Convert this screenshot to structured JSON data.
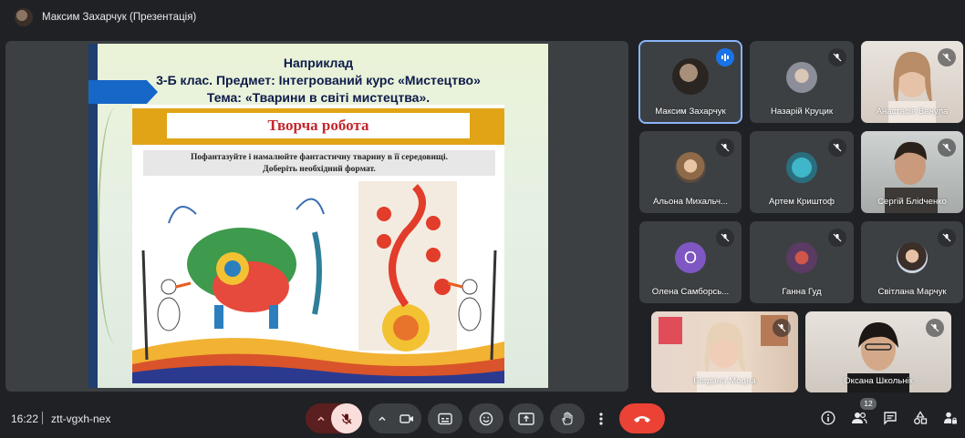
{
  "window": {
    "presenter_title": "Максим Захарчук (Презентація)"
  },
  "slide": {
    "line1": "Наприклад",
    "line2": "3-Б клас. Предмет: Інтегрований курс «Мистецтво»",
    "line3": "Тема: «Тварини в світі мистецтва».",
    "banner": "Творча робота",
    "task_line1": "Пофантазуйте і намалюйте фантастичну тварину в її середовищі.",
    "task_line2": "Доберіть необхідний формат."
  },
  "participants": [
    {
      "name": "Максим Захарчук",
      "state": "speaking"
    },
    {
      "name": "Назарій Круцик",
      "state": "muted"
    },
    {
      "name": "Анастасія Ванула",
      "state": "muted"
    },
    {
      "name": "Альона Михальч...",
      "state": "muted"
    },
    {
      "name": "Артем Криштоф",
      "state": "muted"
    },
    {
      "name": "Сергій Бліdченко",
      "state": "muted"
    },
    {
      "name": "Олена Самборсь...",
      "state": "muted",
      "letter": "О"
    },
    {
      "name": "Ганна Гуд",
      "state": "muted"
    },
    {
      "name": "Світлана Марчук",
      "state": "muted"
    },
    {
      "name": "Богдана Моцна",
      "state": "muted"
    },
    {
      "name": "Оксана Школьнік",
      "state": "muted"
    }
  ],
  "bottom": {
    "time": "16:22",
    "meeting_code": "ztt-vgxh-nex",
    "people_count": "12"
  },
  "colors": {
    "background": "#202124",
    "tile": "#3c4043",
    "end_call": "#ea4335",
    "mic_off_bg": "#f9dedc",
    "active_outline": "#8ab4f8"
  }
}
